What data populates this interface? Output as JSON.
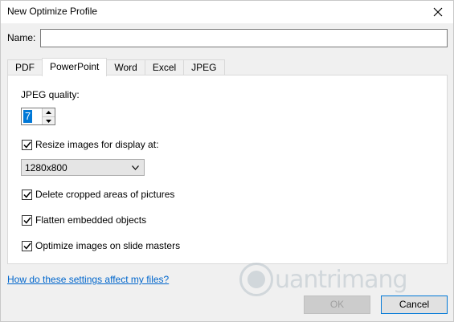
{
  "window": {
    "title": "New Optimize Profile"
  },
  "name_field": {
    "label": "Name:",
    "value": ""
  },
  "tabs": [
    {
      "label": "PDF",
      "active": false
    },
    {
      "label": "PowerPoint",
      "active": true
    },
    {
      "label": "Word",
      "active": false
    },
    {
      "label": "Excel",
      "active": false
    },
    {
      "label": "JPEG",
      "active": false
    }
  ],
  "panel": {
    "jpeg_quality_label": "JPEG quality:",
    "jpeg_quality_value": "7",
    "resize_label": "Resize images for display at:",
    "resize_checked": true,
    "resolution_selected": "1280x800",
    "delete_cropped_label": "Delete cropped areas of pictures",
    "delete_cropped_checked": true,
    "flatten_label": "Flatten embedded objects",
    "flatten_checked": true,
    "optimize_masters_label": "Optimize images on slide masters",
    "optimize_masters_checked": true
  },
  "help_link": "How do these settings affect my files?",
  "buttons": {
    "ok": "OK",
    "cancel": "Cancel"
  },
  "watermark": {
    "text": "uantrimang"
  }
}
